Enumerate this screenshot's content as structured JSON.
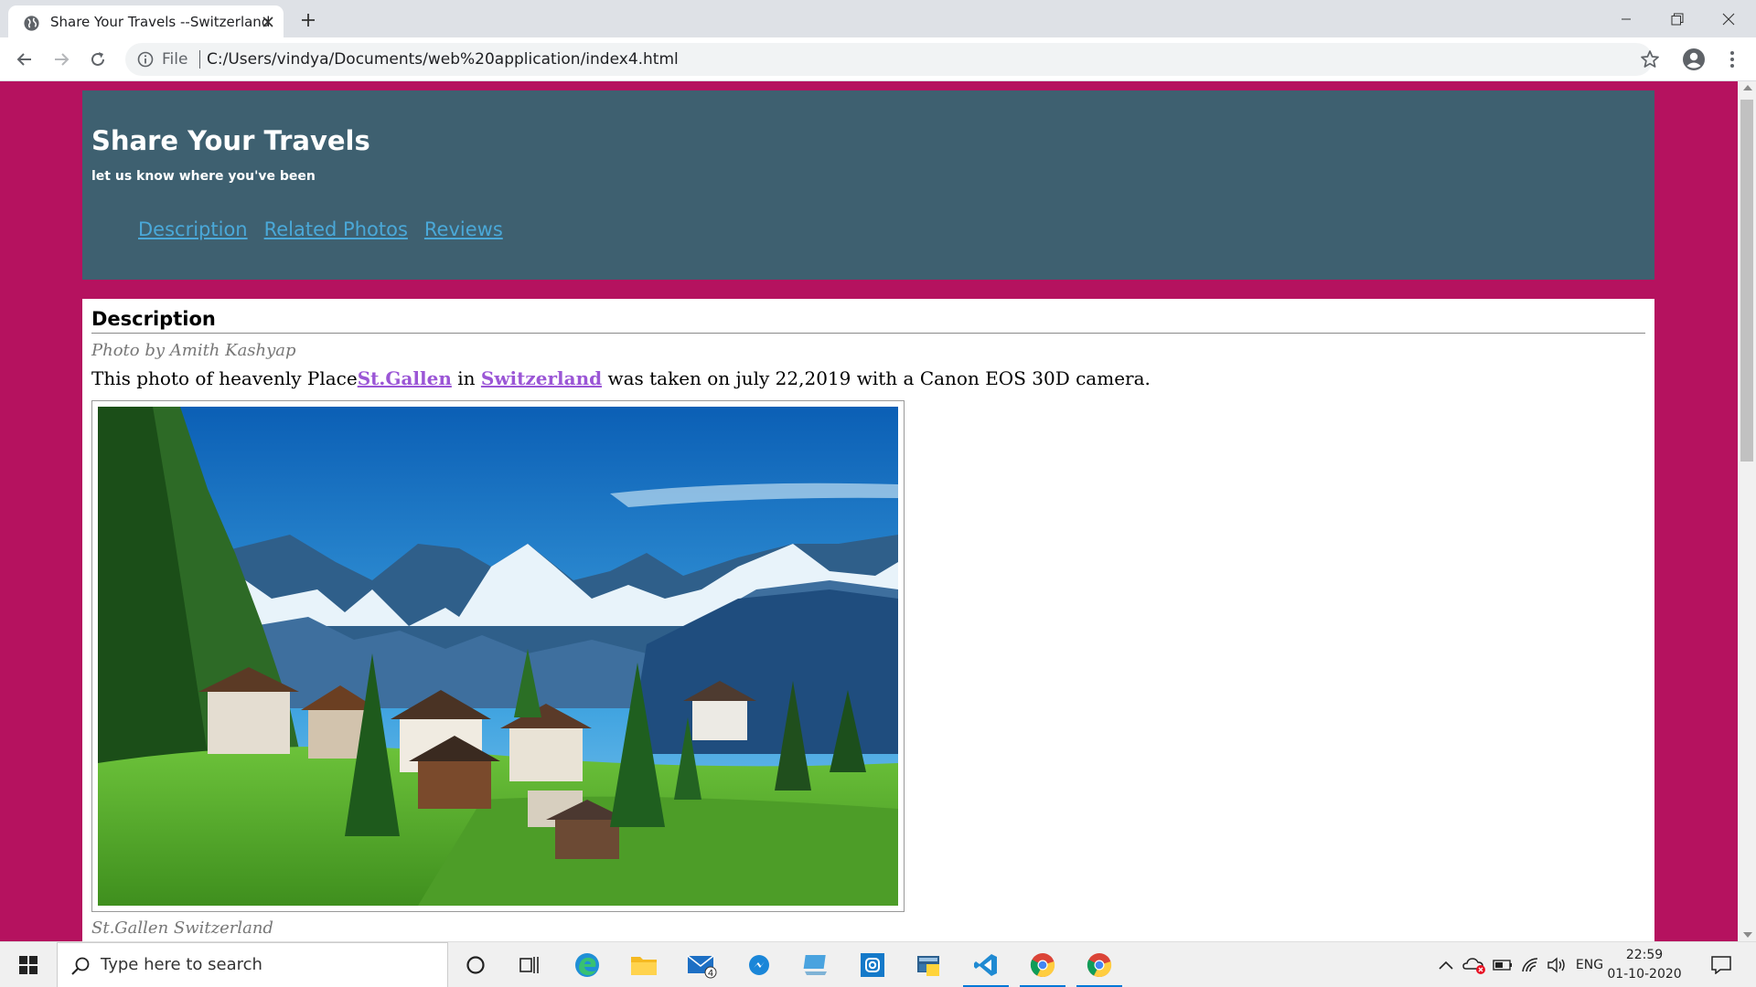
{
  "browser": {
    "tab_title": "Share Your Travels --Switzerland",
    "omnibox_scheme": "File",
    "url": "C:/Users/vindya/Documents/web%20application/index4.html"
  },
  "site": {
    "title": "Share Your Travels",
    "tagline": "let us know where you've been",
    "nav": [
      "Description",
      "Related Photos",
      "Reviews"
    ],
    "link_color": "#4aa8d8",
    "header_color": "#3e6070",
    "page_bg": "#b5125f"
  },
  "content": {
    "heading": "Description",
    "byline": "Photo by Amith Kashyap",
    "sentence_start": "This photo of heavenly Place",
    "place_link": "St.Gallen",
    "sentence_mid": " in ",
    "country_link": "Switzerland",
    "sentence_end": " was taken on july 22,2019 with a Canon EOS 30D camera.",
    "photo_alt": "St.Gallen Switzerland",
    "caption": "St.Gallen Switzerland"
  },
  "taskbar": {
    "search_placeholder": "Type here to search",
    "mail_badge": "4",
    "language": "ENG",
    "time": "22:59",
    "date": "01-10-2020",
    "apps": [
      "cortana-icon",
      "task-view-icon",
      "edge-icon",
      "file-explorer-icon",
      "mail-icon",
      "messenger-icon",
      "pc-icon",
      "instagram-icon",
      "python-icon",
      "vscode-icon",
      "chrome-icon",
      "chrome-icon"
    ]
  }
}
